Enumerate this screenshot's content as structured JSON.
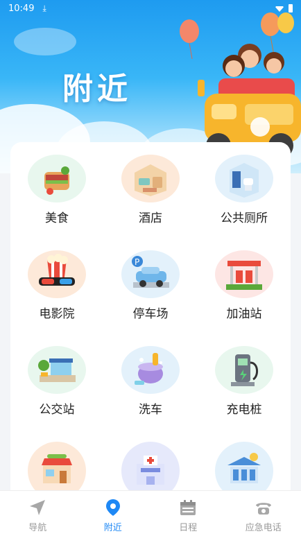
{
  "status": {
    "time": "10:49"
  },
  "hero": {
    "title": "附近"
  },
  "categories": [
    {
      "label": "美食",
      "icon": "food-icon",
      "bg": "#e8f7ee"
    },
    {
      "label": "酒店",
      "icon": "hotel-icon",
      "bg": "#fde9d9"
    },
    {
      "label": "公共厕所",
      "icon": "toilet-icon",
      "bg": "#e3f1fb"
    },
    {
      "label": "电影院",
      "icon": "cinema-icon",
      "bg": "#fde9d9"
    },
    {
      "label": "停车场",
      "icon": "parking-icon",
      "bg": "#e3f1fb"
    },
    {
      "label": "加油站",
      "icon": "gas-station-icon",
      "bg": "#fde6e4"
    },
    {
      "label": "公交站",
      "icon": "bus-stop-icon",
      "bg": "#e8f7ee"
    },
    {
      "label": "洗车",
      "icon": "car-wash-icon",
      "bg": "#e3f1fb"
    },
    {
      "label": "充电桩",
      "icon": "charging-station-icon",
      "bg": "#e8f7ee"
    },
    {
      "label": "",
      "icon": "shop-icon",
      "bg": "#fde9d9"
    },
    {
      "label": "",
      "icon": "hospital-icon",
      "bg": "#e6e9fb"
    },
    {
      "label": "",
      "icon": "bank-icon",
      "bg": "#e3f1fb"
    }
  ],
  "tabs": [
    {
      "label": "导航",
      "icon": "navigation-icon",
      "active": false
    },
    {
      "label": "附近",
      "icon": "location-pin-icon",
      "active": true
    },
    {
      "label": "日程",
      "icon": "calendar-icon",
      "active": false
    },
    {
      "label": "应急电话",
      "icon": "phone-icon",
      "active": false
    }
  ],
  "colors": {
    "accent": "#1e88f5",
    "inactive": "#9a9a9a"
  }
}
